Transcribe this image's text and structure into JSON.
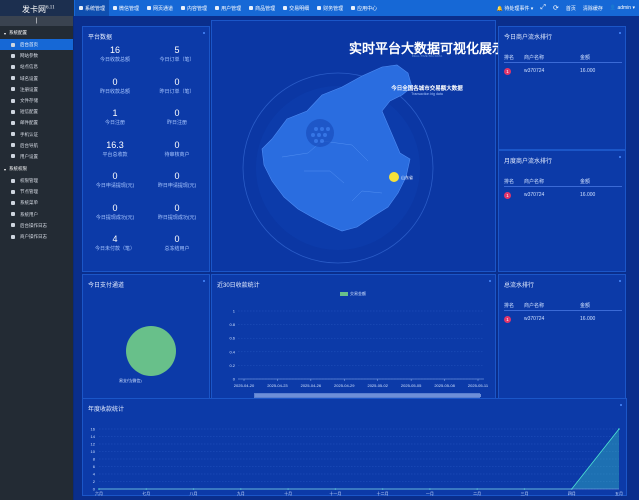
{
  "app": {
    "logo": "发卡网",
    "version": "6.11",
    "collapse_label": "|"
  },
  "topnav": [
    {
      "label": "系统管理",
      "active": true
    },
    {
      "label": "微信管理",
      "active": false
    },
    {
      "label": "网页通道",
      "active": false
    },
    {
      "label": "内容管理",
      "active": false
    },
    {
      "label": "用户管理",
      "active": false
    },
    {
      "label": "商品管理",
      "active": false
    },
    {
      "label": "交易明细",
      "active": false
    },
    {
      "label": "财务管理",
      "active": false
    },
    {
      "label": "应用中心",
      "active": false
    }
  ],
  "topright": {
    "pending": "待处理事件",
    "home": "首页",
    "clear_cache": "清除缓存",
    "user": "admin"
  },
  "sidebar": {
    "groups": [
      {
        "label": "系统配置",
        "items": [
          "后台首页",
          "网站参数",
          "站点信息",
          "域名设置",
          "注册设置",
          "文件存储",
          "短信配置",
          "邮件配置",
          "手机认证",
          "后台导航",
          "用户设置"
        ]
      },
      {
        "label": "系统权限",
        "items": [
          "权限管理",
          "节点管理",
          "系统菜单",
          "系统用户",
          "后台操作日志",
          "商户操作日志"
        ]
      }
    ]
  },
  "platform": {
    "title": "平台数据",
    "stats": [
      {
        "num": "16",
        "label": "今日收款总额"
      },
      {
        "num": "5",
        "label": "今日订单（笔）"
      },
      {
        "num": "0",
        "label": "昨日收款总额"
      },
      {
        "num": "0",
        "label": "昨日订单（笔）"
      },
      {
        "num": "1",
        "label": "今日注册"
      },
      {
        "num": "0",
        "label": "昨日注册"
      },
      {
        "num": "16.3",
        "label": "平台总收款"
      },
      {
        "num": "0",
        "label": "待审核商户"
      },
      {
        "num": "0",
        "label": "今日申请提现(元)"
      },
      {
        "num": "0",
        "label": "昨日申请提现(元)"
      },
      {
        "num": "0",
        "label": "今日提现成功(元)"
      },
      {
        "num": "0",
        "label": "昨日提现成功(元)"
      },
      {
        "num": "4",
        "label": "今日未付款（笔）"
      },
      {
        "num": "0",
        "label": "总冻结用户"
      }
    ]
  },
  "center": {
    "title": "实时平台大数据可视化展示",
    "subtitle": "REAL-TIME BIG DATA",
    "map_title": "今日全国各城市交易额大数据",
    "map_subtitle": "Transaction big data",
    "map_point": "山东省"
  },
  "rank_today": {
    "title": "今日商户流水排行",
    "headers": [
      "排名",
      "商户名称",
      "金额"
    ],
    "rows": [
      {
        "rank": "1",
        "name": "w370724",
        "amount": "16.000"
      }
    ]
  },
  "rank_month": {
    "title": "月度商户流水排行",
    "headers": [
      "排名",
      "商户名称",
      "金额"
    ],
    "rows": [
      {
        "rank": "1",
        "name": "w370724",
        "amount": "16.000"
      }
    ]
  },
  "rank_total": {
    "title": "总流水排行",
    "headers": [
      "排名",
      "商户名称",
      "金额"
    ],
    "rows": [
      {
        "rank": "1",
        "name": "w370724",
        "amount": "16.000"
      }
    ]
  },
  "pay_channel": {
    "title": "今日支付通道",
    "slice_label": "易支付(微信)",
    "color": "#68c08a"
  },
  "chart_30": {
    "title": "近30日收款统计",
    "chart_data": {
      "type": "bar",
      "legend": [
        "交易金额"
      ],
      "categories": [
        "2025-04-20",
        "2025-04-23",
        "2025-04-26",
        "2025-04-29",
        "2025-05-02",
        "2025-05-05",
        "2025-05-08",
        "2025-05-11"
      ],
      "yticks": [
        "0",
        "0.2",
        "0.4",
        "0.6",
        "0.8",
        "1"
      ],
      "ylim": [
        0,
        1
      ]
    }
  },
  "chart_year": {
    "title": "年度收款统计",
    "chart_data": {
      "type": "area",
      "categories": [
        "六月",
        "七月",
        "八月",
        "九月",
        "十月",
        "十一月",
        "十二月",
        "一月",
        "二月",
        "三月",
        "四月",
        "五月"
      ],
      "values": [
        0,
        0,
        0,
        0,
        0,
        0,
        0,
        0,
        0,
        0,
        0,
        16
      ],
      "yticks": [
        "0",
        "2",
        "4",
        "6",
        "8",
        "10",
        "12",
        "14",
        "16"
      ],
      "ylim": [
        0,
        16
      ]
    }
  }
}
